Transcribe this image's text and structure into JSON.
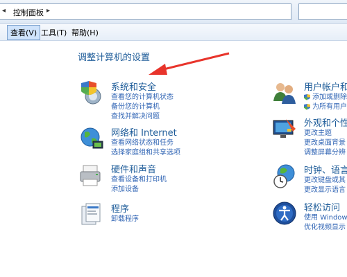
{
  "address": {
    "crumb": "控制面板",
    "arrow_left": "◂",
    "arrow_right": "▸"
  },
  "menu": [
    {
      "label": "查看(V)",
      "active": true
    },
    {
      "label": "工具(T)",
      "active": false
    },
    {
      "label": "帮助(H)",
      "active": false
    }
  ],
  "main": {
    "title": "调整计算机的设置",
    "left": [
      {
        "title": "系统和安全",
        "links": [
          "查看您的计算机状态",
          "备份您的计算机",
          "查找并解决问题"
        ]
      },
      {
        "title": "网络和 Internet",
        "links": [
          "查看网络状态和任务",
          "选择家庭组和共享选项"
        ]
      },
      {
        "title": "硬件和声音",
        "links": [
          "查看设备和打印机",
          "添加设备"
        ]
      },
      {
        "title": "程序",
        "links": [
          "卸载程序"
        ]
      }
    ],
    "right": [
      {
        "title": "用户帐户和",
        "links": [
          "添加或删除",
          "为所有用户"
        ]
      },
      {
        "title": "外观和个性",
        "links": [
          "更改主题",
          "更改桌面背景",
          "调整屏幕分辨"
        ]
      },
      {
        "title": "时钟、语言",
        "links": [
          "更改键盘或其",
          "更改显示语言"
        ]
      },
      {
        "title": "轻松访问",
        "links": [
          "使用 Windows",
          "优化视频显示"
        ]
      }
    ]
  },
  "colors": {
    "link": "#3266b5",
    "heading": "#1e5c99",
    "arrow": "#e8342b"
  }
}
